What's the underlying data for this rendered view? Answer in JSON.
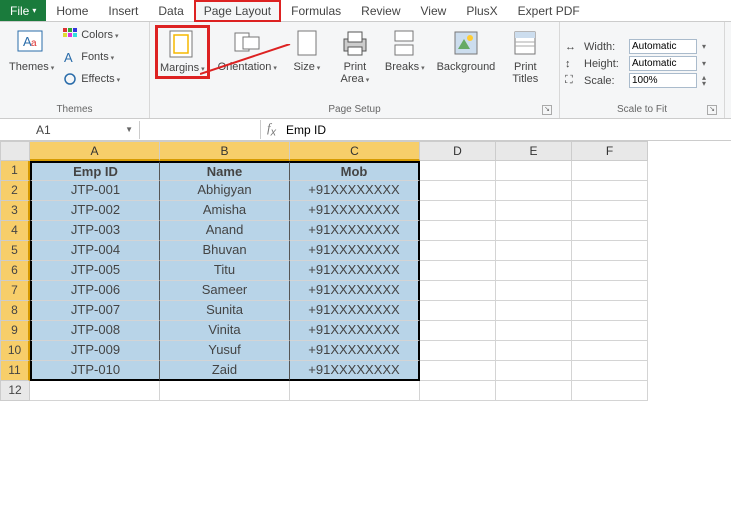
{
  "tabs": {
    "file": "File",
    "items": [
      "Home",
      "Insert",
      "Data",
      "Page Layout",
      "Formulas",
      "Review",
      "View",
      "PlusX",
      "Expert PDF"
    ],
    "active": "Page Layout",
    "highlighted": "Page Layout"
  },
  "ribbon": {
    "themes": {
      "label": "Themes",
      "themes_btn": "Themes",
      "colors": "Colors",
      "fonts": "Fonts",
      "effects": "Effects"
    },
    "page_setup": {
      "label": "Page Setup",
      "margins": "Margins",
      "orientation": "Orientation",
      "size": "Size",
      "print_area": "Print\nArea",
      "breaks": "Breaks",
      "background": "Background",
      "print_titles": "Print\nTitles"
    },
    "scale_to_fit": {
      "label": "Scale to Fit",
      "width_lbl": "Width:",
      "width_val": "Automatic",
      "height_lbl": "Height:",
      "height_val": "Automatic",
      "scale_lbl": "Scale:",
      "scale_val": "100%"
    }
  },
  "namebox": "A1",
  "formula": "Emp ID",
  "columns": [
    "A",
    "B",
    "C",
    "D",
    "E",
    "F"
  ],
  "sel_cols": [
    "A",
    "B",
    "C"
  ],
  "rows_visible": 12,
  "sel_rows": 11,
  "table": {
    "headers": [
      "Emp ID",
      "Name",
      "Mob"
    ],
    "rows": [
      [
        "JTP-001",
        "Abhigyan",
        "+91XXXXXXXX"
      ],
      [
        "JTP-002",
        "Amisha",
        "+91XXXXXXXX"
      ],
      [
        "JTP-003",
        "Anand",
        "+91XXXXXXXX"
      ],
      [
        "JTP-004",
        "Bhuvan",
        "+91XXXXXXXX"
      ],
      [
        "JTP-005",
        "Titu",
        "+91XXXXXXXX"
      ],
      [
        "JTP-006",
        "Sameer",
        "+91XXXXXXXX"
      ],
      [
        "JTP-007",
        "Sunita",
        "+91XXXXXXXX"
      ],
      [
        "JTP-008",
        "Vinita",
        "+91XXXXXXXX"
      ],
      [
        "JTP-009",
        "Yusuf",
        "+91XXXXXXXX"
      ],
      [
        "JTP-010",
        "Zaid",
        "+91XXXXXXXX"
      ]
    ]
  }
}
